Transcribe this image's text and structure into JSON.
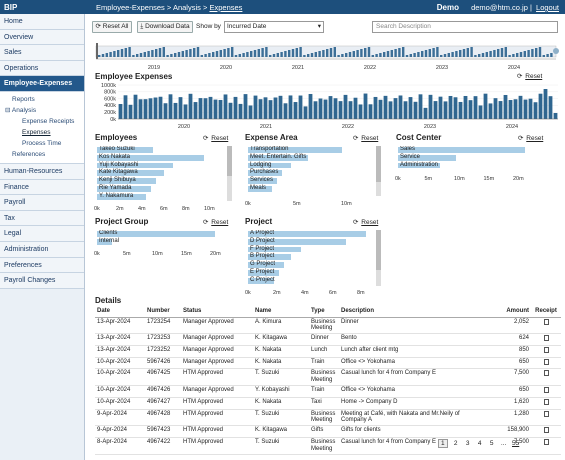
{
  "header": {
    "brand": "BIP",
    "breadcrumb_1": "Employee-Expenses",
    "sep": ">",
    "breadcrumb_2": "Analysis",
    "breadcrumb_3": "Expenses",
    "company": "Demo",
    "user": "demo@htm.co.jp",
    "divider": "|",
    "logout": "Logout"
  },
  "sidebar": {
    "items_top": [
      "Home",
      "Overview",
      "Sales",
      "Operations"
    ],
    "active": "Employee-Expenses",
    "reports": "Reports",
    "analysis": "Analysis",
    "analysis_toggle": "⊟",
    "analysis_items": [
      "Expense Receipts",
      "Expenses",
      "Process Time"
    ],
    "references": "References",
    "items_bottom": [
      "Human-Resources",
      "Finance",
      "Payroll",
      "Tax",
      "Legal",
      "Administration",
      "Preferences",
      "Payroll Changes"
    ]
  },
  "toolbar": {
    "reset_all": "Reset All",
    "download": "Download Data",
    "show_by_label": "Show by",
    "show_by_value": "Incurred Date",
    "search_placeholder": "Search Description"
  },
  "timeline": {
    "years": [
      "2019",
      "2020",
      "2021",
      "2022",
      "2023",
      "2024"
    ]
  },
  "employee_expenses": {
    "title": "Employee Expenses",
    "reset": "Reset",
    "yticks": [
      "1000k",
      "800k",
      "600k",
      "400k",
      "200k",
      "0k"
    ],
    "years": [
      "2020",
      "2021",
      "2022",
      "2023",
      "2024"
    ]
  },
  "employees": {
    "title": "Employees",
    "reset": "Reset",
    "ticks": [
      "0k",
      "2m",
      "4m",
      "6m",
      "8m",
      "10m"
    ],
    "rows": [
      {
        "label": "Takeo Suzuki",
        "value": 0.46
      },
      {
        "label": "Kos Nakata",
        "value": 0.88
      },
      {
        "label": "Yuji Kobayashi",
        "value": 0.62
      },
      {
        "label": "Kate Kitagawa",
        "value": 0.55
      },
      {
        "label": "Kenji Shibuya",
        "value": 0.48
      },
      {
        "label": "Rie Yamada",
        "value": 0.44
      },
      {
        "label": "Y. Nakamura",
        "value": 0.4
      }
    ]
  },
  "expense_area": {
    "title": "Expense Area",
    "reset": "Reset",
    "ticks": [
      "0k",
      "5m",
      "10m"
    ],
    "rows": [
      {
        "label": "Transportation",
        "value": 0.78
      },
      {
        "label": "Meet. Entertain. Gifts",
        "value": 0.5
      },
      {
        "label": "Lodging",
        "value": 0.36
      },
      {
        "label": "Purchases",
        "value": 0.28
      },
      {
        "label": "Services",
        "value": 0.24
      },
      {
        "label": "Meals",
        "value": 0.2
      }
    ]
  },
  "cost_center": {
    "title": "Cost Center",
    "reset": "Reset",
    "ticks": [
      "0k",
      "5m",
      "10m",
      "15m",
      "20m"
    ],
    "rows": [
      {
        "label": "Sales",
        "value": 0.96
      },
      {
        "label": "Service",
        "value": 0.44
      },
      {
        "label": "Administration",
        "value": 0.32
      }
    ]
  },
  "project_group": {
    "title": "Project Group",
    "reset": "Reset",
    "ticks": [
      "0k",
      "5m",
      "10m",
      "15m",
      "20m"
    ],
    "rows": [
      {
        "label": "Clients",
        "value": 0.97
      },
      {
        "label": "Internal",
        "value": 0.12
      }
    ]
  },
  "project": {
    "title": "Project",
    "reset": "Reset",
    "ticks": [
      "0k",
      "2m",
      "4m",
      "6m",
      "8m"
    ],
    "rows": [
      {
        "label": "A Project",
        "value": 0.98
      },
      {
        "label": "D Project",
        "value": 0.82
      },
      {
        "label": "F Project",
        "value": 0.44
      },
      {
        "label": "B Project",
        "value": 0.36
      },
      {
        "label": "G Project",
        "value": 0.3
      },
      {
        "label": "E Project",
        "value": 0.26
      },
      {
        "label": "C Project",
        "value": 0.22
      }
    ]
  },
  "details": {
    "title": "Details",
    "columns": [
      "Date",
      "Number",
      "Status",
      "Name",
      "Type",
      "Description",
      "Amount",
      "Receipt"
    ],
    "rows": [
      {
        "date": "13-Apr-2024",
        "number": "1723254",
        "status": "Manager Approved",
        "name": "A. Kimura",
        "type": "Business Meeting",
        "desc": "Dinner",
        "amount": "2,052"
      },
      {
        "date": "13-Apr-2024",
        "number": "1723253",
        "status": "Manager Approved",
        "name": "K. Kitagawa",
        "type": "Dinner",
        "desc": "Bento",
        "amount": "624"
      },
      {
        "date": "13-Apr-2024",
        "number": "1723252",
        "status": "Manager Approved",
        "name": "K. Nakata",
        "type": "Lunch",
        "desc": "Lunch after client mtg",
        "amount": "850"
      },
      {
        "date": "10-Apr-2024",
        "number": "5967426",
        "status": "Manager Approved",
        "name": "K. Nakata",
        "type": "Train",
        "desc": "Office <> Yokohama",
        "amount": "650"
      },
      {
        "date": "10-Apr-2024",
        "number": "4967425",
        "status": "HTM Approved",
        "name": "T. Suzuki",
        "type": "Business Meeting",
        "desc": "Casual lunch for 4 from Company E",
        "amount": "7,500"
      },
      {
        "date": "10-Apr-2024",
        "number": "4967426",
        "status": "Manager Approved",
        "name": "Y. Kobayashi",
        "type": "Train",
        "desc": "Office <> Yokohama",
        "amount": "650"
      },
      {
        "date": "10-Apr-2024",
        "number": "4967427",
        "status": "HTM Approved",
        "name": "K. Nakata",
        "type": "Taxi",
        "desc": "Home -> Company D",
        "amount": "1,620"
      },
      {
        "date": "9-Apr-2024",
        "number": "4967428",
        "status": "HTM Approved",
        "name": "T. Suzuki",
        "type": "Business Meeting",
        "desc": "Meeting at Café, with Nakata and Mr.Neily of Company A",
        "amount": "1,280"
      },
      {
        "date": "9-Apr-2024",
        "number": "5967423",
        "status": "HTM Approved",
        "name": "K. Kitagawa",
        "type": "Gifts",
        "desc": "Gifts for clients",
        "amount": "158,900"
      },
      {
        "date": "8-Apr-2024",
        "number": "4967422",
        "status": "HTM Approved",
        "name": "T. Suzuki",
        "type": "Business Meeting",
        "desc": "Casual lunch for 4 from Company E",
        "amount": "7,500"
      }
    ]
  },
  "pager": {
    "pages": [
      "1",
      "2",
      "3",
      "4",
      "5"
    ],
    "ellipsis": "...",
    "last": "55",
    "current": "1"
  }
}
